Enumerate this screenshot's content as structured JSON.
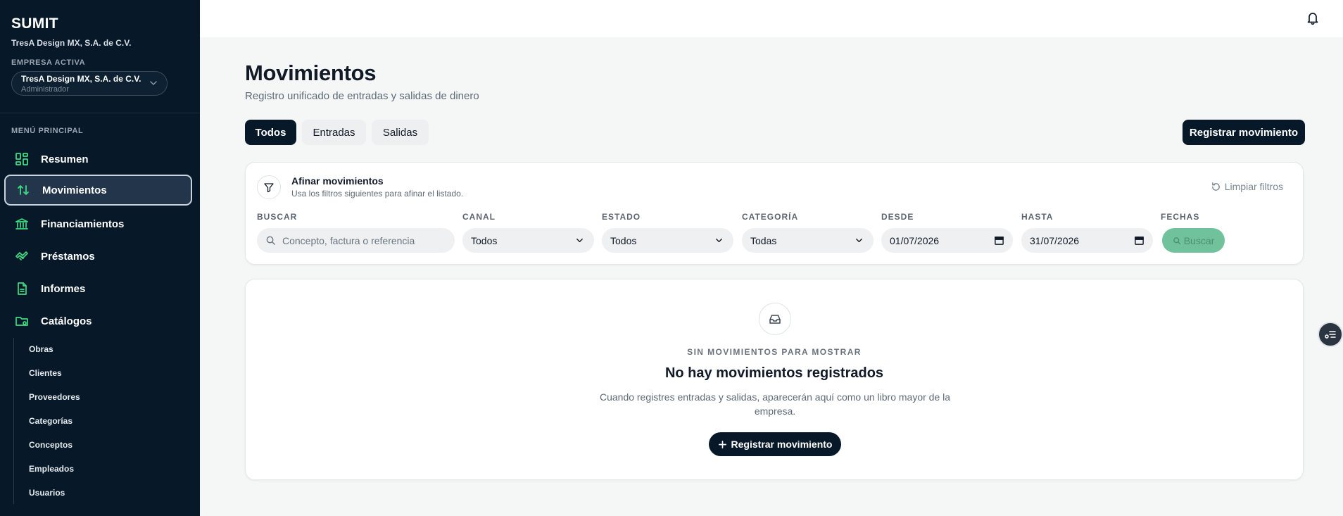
{
  "colors": {
    "sidebar_bg": "#071828",
    "accent_green": "#3ddc84",
    "primary": "#071828",
    "search_disabled": "#6fc29b"
  },
  "sidebar": {
    "brand": "SUMIT",
    "company": "TresA Design MX, S.A. de C.V.",
    "active_company_label": "EMPRESA ACTIVA",
    "company_select": {
      "name": "TresA Design MX, S.A. de C.V.",
      "role": "Administrador"
    },
    "menu_label": "MENÚ PRINCIPAL",
    "items": [
      {
        "label": "Resumen",
        "icon": "dashboard-icon"
      },
      {
        "label": "Movimientos",
        "icon": "arrows-up-down-icon",
        "active": true
      },
      {
        "label": "Financiamientos",
        "icon": "bank-icon"
      },
      {
        "label": "Préstamos",
        "icon": "handshake-icon"
      },
      {
        "label": "Informes",
        "icon": "document-icon"
      },
      {
        "label": "Catálogos",
        "icon": "folder-gear-icon"
      }
    ],
    "sub_items": [
      "Obras",
      "Clientes",
      "Proveedores",
      "Categorías",
      "Conceptos",
      "Empleados",
      "Usuarios"
    ]
  },
  "topbar": {
    "icon": "bell-icon"
  },
  "main": {
    "title": "Movimientos",
    "subtitle": "Registro unificado de entradas y salidas de dinero",
    "tabs": [
      {
        "label": "Todos",
        "active": true
      },
      {
        "label": "Entradas"
      },
      {
        "label": "Salidas"
      }
    ],
    "register_button": "Registrar movimiento"
  },
  "filters": {
    "title": "Afinar movimientos",
    "hint": "Usa los filtros siguientes para afinar el listado.",
    "clear": "Limpiar filtros",
    "search": {
      "label": "BUSCAR",
      "placeholder": "Concepto, factura o referencia"
    },
    "canal": {
      "label": "CANAL",
      "value": "Todos"
    },
    "estado": {
      "label": "ESTADO",
      "value": "Todos"
    },
    "categoria": {
      "label": "CATEGORÍA",
      "value": "Todas"
    },
    "desde": {
      "label": "DESDE",
      "value": "01/07/2026"
    },
    "hasta": {
      "label": "HASTA",
      "value": "31/07/2026"
    },
    "fechas": {
      "label": "FECHAS",
      "button": "Buscar"
    }
  },
  "empty": {
    "kicker": "SIN MOVIMIENTOS PARA MOSTRAR",
    "title": "No hay movimientos registrados",
    "description": "Cuando registres entradas y salidas, aparecerán aquí como un libro mayor de la empresa.",
    "button": "Registrar movimiento"
  }
}
